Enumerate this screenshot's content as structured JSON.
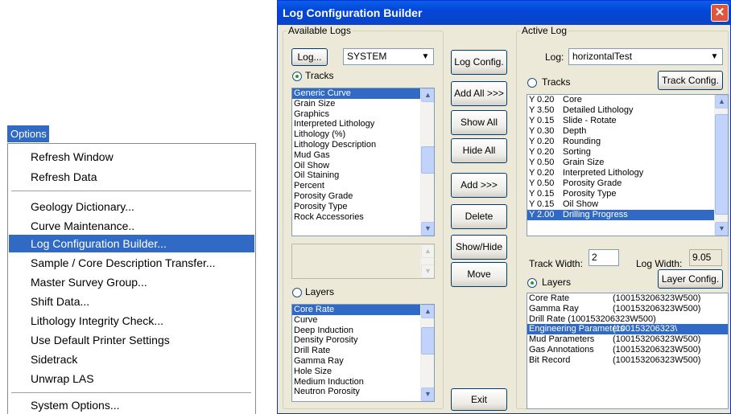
{
  "options_menu": {
    "title": "Options",
    "items": [
      "Refresh Window",
      "Refresh Data",
      "Geology Dictionary...",
      "Curve Maintenance..",
      "Log Configuration Builder...",
      "Sample / Core Description Transfer...",
      "Master Survey Group...",
      "Shift Data...",
      "Lithology Integrity Check...",
      "Use Default Printer Settings",
      "Sidetrack",
      "Unwrap LAS",
      "System Options..."
    ],
    "selected_index": 4
  },
  "dialog": {
    "title": "Log Configuration Builder",
    "close_glyph": "✕"
  },
  "available_logs": {
    "legend": "Available Logs",
    "log_button": "Log...",
    "log_select": "SYSTEM",
    "tracks_radio": "Tracks",
    "tracks_list": [
      "Generic Curve",
      "Grain Size",
      "Graphics",
      "Interpreted Lithology",
      "Lithology (%)",
      "Lithology Description",
      "Mud Gas",
      "Oil Show",
      "Oil Staining",
      "Percent",
      "Porosity Grade",
      "Porosity Type",
      "Rock Accessories"
    ],
    "layers_radio": "Layers",
    "layers_list": [
      "Core Rate",
      "Curve",
      "Deep Induction",
      "Density Porosity",
      "Drill Rate",
      "Gamma Ray",
      "Hole Size",
      "Medium Induction",
      "Neutron Porosity"
    ]
  },
  "middle_buttons": {
    "log_config": "Log Config.",
    "add_all": "Add All >>>",
    "show_all": "Show All",
    "hide_all": "Hide All",
    "add": "Add >>>",
    "delete": "Delete",
    "show_hide": "Show/Hide",
    "move": "Move",
    "exit": "Exit"
  },
  "active_log": {
    "legend": "Active Log",
    "log_label": "Log:",
    "log_select": "horizontalTest",
    "tracks_radio": "Tracks",
    "track_config": "Track Config.",
    "tracks": [
      {
        "flag": "Y",
        "width": "0.20",
        "name": "Core"
      },
      {
        "flag": "Y",
        "width": "3.50",
        "name": "Detailed Lithology"
      },
      {
        "flag": "Y",
        "width": "0.15",
        "name": "Slide - Rotate"
      },
      {
        "flag": "Y",
        "width": "0.30",
        "name": "Depth"
      },
      {
        "flag": "Y",
        "width": "0.20",
        "name": "Rounding"
      },
      {
        "flag": "Y",
        "width": "0.20",
        "name": "Sorting"
      },
      {
        "flag": "Y",
        "width": "0.50",
        "name": "Grain Size"
      },
      {
        "flag": "Y",
        "width": "0.20",
        "name": "Interpreted Lithology"
      },
      {
        "flag": "Y",
        "width": "0.50",
        "name": "Porosity Grade"
      },
      {
        "flag": "Y",
        "width": "0.15",
        "name": "Porosity Type"
      },
      {
        "flag": "Y",
        "width": "0.15",
        "name": "Oil Show"
      },
      {
        "flag": "Y",
        "width": "2.00",
        "name": "Drilling Progress"
      }
    ],
    "track_width_label": "Track Width:",
    "track_width_value": "2",
    "log_width_label": "Log Width:",
    "log_width_value": "9.05",
    "layers_radio": "Layers",
    "layer_config": "Layer Config.",
    "layers": [
      {
        "name": "Core Rate",
        "id": "(100153206323W500)"
      },
      {
        "name": "Gamma Ray",
        "id": "(100153206323W500)"
      },
      {
        "name": "Drill Rate (100153206323W500)",
        "id": ""
      },
      {
        "name": "Engineering Parameters",
        "id": "(100153206323\\"
      },
      {
        "name": "Mud Parameters",
        "id": "(100153206323W500)"
      },
      {
        "name": "Gas Annotations",
        "id": "(100153206323W500)"
      },
      {
        "name": "Bit Record",
        "id": "(100153206323W500)"
      }
    ]
  }
}
